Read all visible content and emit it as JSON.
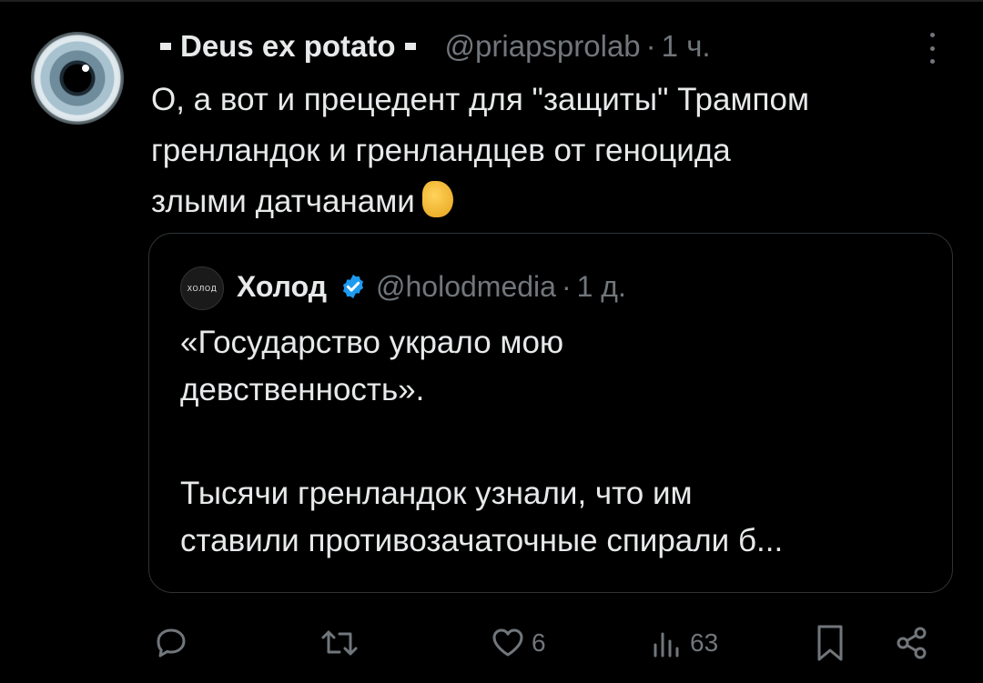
{
  "post": {
    "author_name": "Deus ex potato",
    "handle": "@priapsprolab",
    "separator": "·",
    "time": "1 ч.",
    "text_line1": "О, а вот и прецедент для \"защиты\" Трампом",
    "text_line2": "гренландок и гренландцев от геноцида",
    "text_line3": "злыми датчанами",
    "emoji": "pinching-hand-emoji"
  },
  "quote": {
    "avatar_label": "ХОЛОД",
    "author_name": "Холод",
    "handle": "@holodmedia",
    "separator": "·",
    "time": "1 д.",
    "line1": "«Государство украло мою",
    "line2": "девственность».",
    "line3": "Тысячи гренландок узнали, что им",
    "line4": "ставили противозачаточные спирали б..."
  },
  "actions": {
    "replies": "",
    "reposts": "",
    "likes": "6",
    "views": "63"
  },
  "colors": {
    "background": "#000000",
    "text": "#e7e9ea",
    "muted": "#71767b",
    "verified": "#1d9bf0",
    "border": "#2f3336"
  }
}
